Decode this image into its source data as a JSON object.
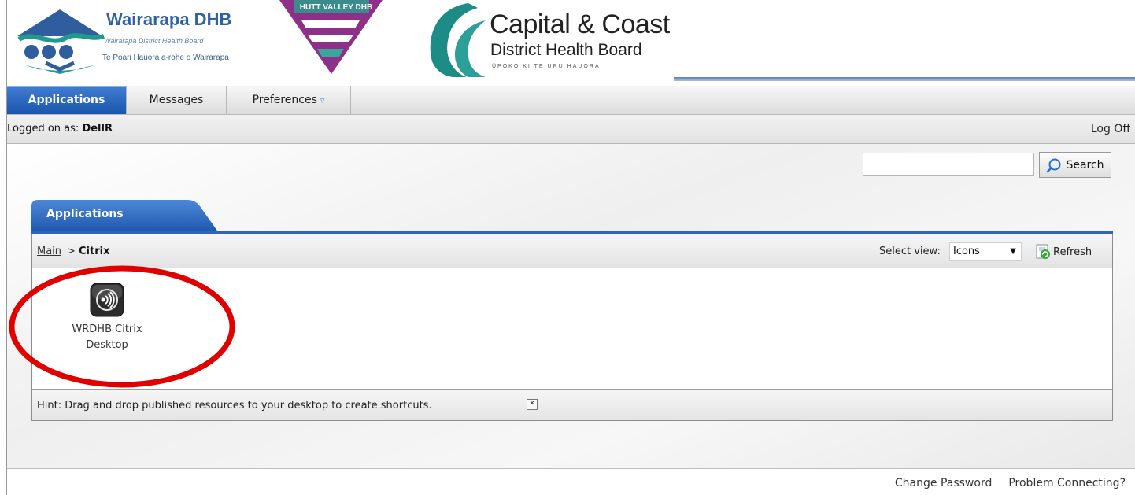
{
  "header": {
    "wairarapa": {
      "name": "Wairarapa DHB",
      "subtitle": "Wairarapa District Health Board",
      "maori": "Te Poari Hauora a-rohe o Wairarapa"
    },
    "hutt": {
      "name": "HUTT VALLEY DHB"
    },
    "ccdhb": {
      "title": "Capital & Coast",
      "subtitle": "District Health Board",
      "maori": "ŪPOKO KI TE URU HAUORA"
    }
  },
  "nav": {
    "tabs": [
      {
        "label": "Applications",
        "active": true
      },
      {
        "label": "Messages",
        "active": false
      },
      {
        "label": "Preferences",
        "active": false
      }
    ]
  },
  "status": {
    "logged_on_label": "Logged on as:",
    "user": "DellR",
    "logoff": "Log Off"
  },
  "search": {
    "value": "",
    "button_label": "Search"
  },
  "panel": {
    "tab_label": "Applications",
    "breadcrumb": {
      "root": "Main",
      "separator": ">",
      "current": "Citrix"
    },
    "select_view_label": "Select view:",
    "select_view_value": "Icons",
    "refresh_label": "Refresh",
    "apps": [
      {
        "label_line1": "WRDHB Citrix",
        "label_line2": "Desktop",
        "icon": "citrix-receiver-icon"
      }
    ],
    "hint": "Hint: Drag and drop published resources to your desktop to create shortcuts."
  },
  "footer": {
    "change_password": "Change Password",
    "problem_connecting": "Problem Connecting?"
  },
  "colors": {
    "accent_blue": "#1b56ad",
    "highlight_red": "#e00000"
  }
}
